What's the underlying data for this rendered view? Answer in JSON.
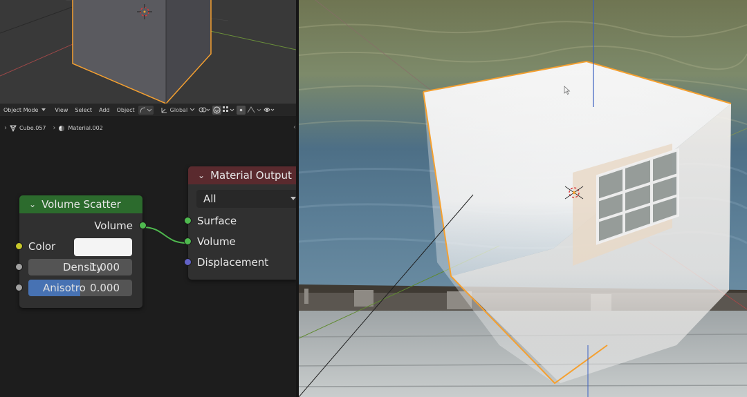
{
  "header": {
    "mode_label": "Object Mode",
    "menus": [
      "View",
      "Select",
      "Add",
      "Object"
    ],
    "transform_orientation": "Global"
  },
  "breadcrumb": {
    "object": "Cube.057",
    "material": "Material.002"
  },
  "volume_scatter": {
    "title": "Volume Scatter",
    "output_label": "Volume",
    "color_label": "Color",
    "density_label": "Density",
    "density_value": "1.000",
    "anisotropy_label": "Anisotro",
    "anisotropy_value": "0.000",
    "anisotropy_fill": 0.5
  },
  "material_output": {
    "title": "Material Output",
    "target": "All",
    "inputs": [
      "Surface",
      "Volume",
      "Displacement"
    ]
  },
  "colors": {
    "selection_outline": "#f5a030",
    "volume_scatter_header": "#2c6b2d",
    "material_output_header": "#5a2a2e",
    "shader_socket": "#4fba4f",
    "color_socket": "#c7c72a",
    "float_socket": "#a1a1a1",
    "vector_socket": "#6363c7",
    "slider_fill": "#4772b3"
  }
}
